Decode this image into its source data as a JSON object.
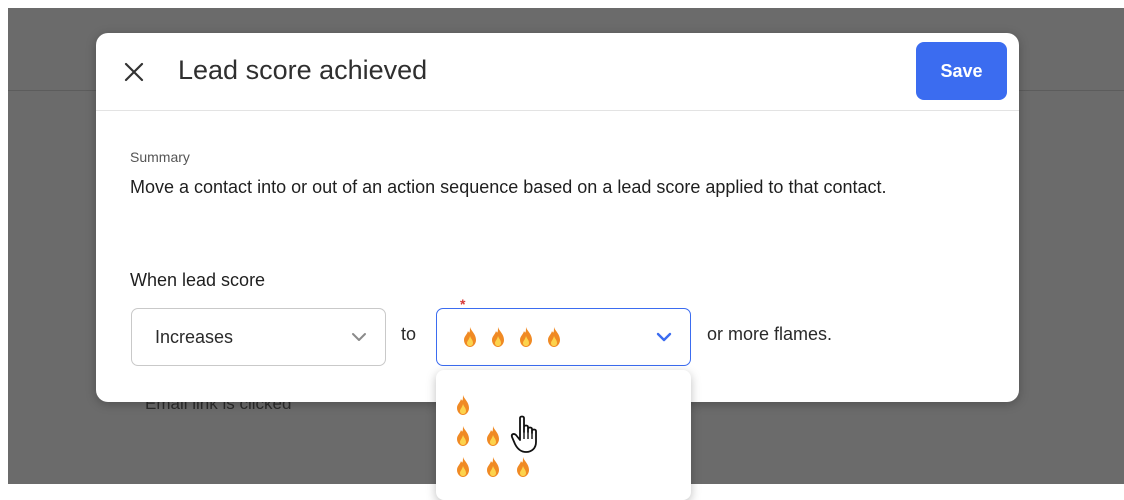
{
  "background": {
    "partial_text": "Email link is clicked"
  },
  "modal": {
    "title": "Lead score achieved",
    "close_icon": "close-icon",
    "save_label": "Save",
    "summary_label": "Summary",
    "summary_text": "Move a contact into or out of an action sequence based on a lead score applied to that contact.",
    "when_label": "When lead score",
    "direction_select": {
      "value": "Increases"
    },
    "to_label": "to",
    "flames_select": {
      "required_marker": "*",
      "selected_flames": 4
    },
    "suffix_label": "or more flames.",
    "flame_options": [
      1,
      2,
      3
    ]
  },
  "colors": {
    "accent": "#3b6cf0",
    "backdrop": "#6b6b6b",
    "required": "#d63a3a",
    "flame_outer": "#f08a24",
    "flame_inner": "#fcd34d"
  }
}
